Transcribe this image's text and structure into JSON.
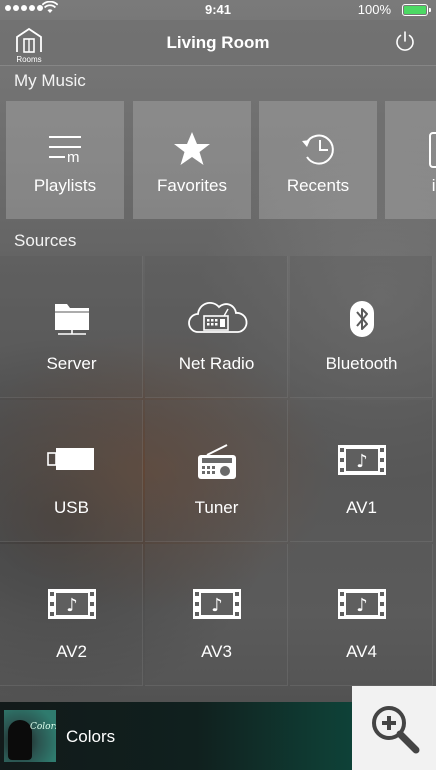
{
  "status_bar": {
    "time": "9:41",
    "battery": "100%",
    "battery_color": "#4cd964",
    "icons": [
      "signal-dots-icon",
      "wifi-icon",
      "battery-icon"
    ]
  },
  "nav": {
    "title": "Living Room",
    "rooms_label": "Rooms",
    "left_icon": "house-icon",
    "right_icon": "power-icon"
  },
  "my_music": {
    "heading": "My Music",
    "items": [
      {
        "label": "Playlists",
        "icon": "playlist-icon"
      },
      {
        "label": "Favorites",
        "icon": "star-icon"
      },
      {
        "label": "Recents",
        "icon": "history-clock-icon"
      },
      {
        "label": "iPh",
        "icon": "phone-icon"
      }
    ]
  },
  "sources": {
    "heading": "Sources",
    "items": [
      {
        "label": "Server",
        "icon": "folder-icon"
      },
      {
        "label": "Net Radio",
        "icon": "cloud-radio-icon"
      },
      {
        "label": "Bluetooth",
        "icon": "bluetooth-icon"
      },
      {
        "label": "USB",
        "icon": "usb-stick-icon"
      },
      {
        "label": "Tuner",
        "icon": "radio-icon"
      },
      {
        "label": "AV1",
        "icon": "film-music-icon"
      },
      {
        "label": "AV2",
        "icon": "film-music-icon"
      },
      {
        "label": "AV3",
        "icon": "film-music-icon"
      },
      {
        "label": "AV4",
        "icon": "film-music-icon"
      }
    ]
  },
  "now_playing": {
    "track": "Colors",
    "album_script": "Colors",
    "accent": "#0a5145"
  },
  "zoom": {
    "icon": "zoom-in-icon"
  }
}
